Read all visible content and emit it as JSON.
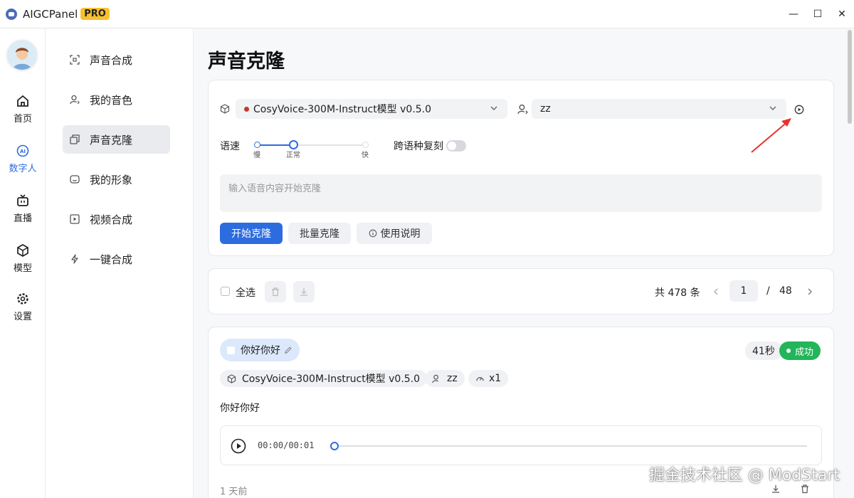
{
  "app": {
    "title": "AIGCPanel",
    "badge": "PRO"
  },
  "window_controls": {
    "minimize": "—",
    "maximize": "☐",
    "close": "✕"
  },
  "rail": {
    "items": [
      {
        "label": "首页",
        "icon": "home-icon"
      },
      {
        "label": "数字人",
        "icon": "ai-icon"
      },
      {
        "label": "直播",
        "icon": "tv-icon"
      },
      {
        "label": "模型",
        "icon": "cube-icon"
      },
      {
        "label": "设置",
        "icon": "gear-icon"
      }
    ],
    "active": "数字人"
  },
  "subnav": {
    "items": [
      {
        "label": "声音合成",
        "icon": "scan-icon"
      },
      {
        "label": "我的音色",
        "icon": "user-voice-icon"
      },
      {
        "label": "声音克隆",
        "icon": "copy-icon"
      },
      {
        "label": "我的形象",
        "icon": "face-icon"
      },
      {
        "label": "视频合成",
        "icon": "video-icon"
      },
      {
        "label": "一键合成",
        "icon": "bolt-icon"
      }
    ],
    "active": "声音克隆"
  },
  "page": {
    "title": "声音克隆"
  },
  "form": {
    "model_select": "CosyVoice-300M-Instruct模型 v0.5.0",
    "model_status_color": "#c0392b",
    "voice_select": "zz",
    "speed_label": "语速",
    "speed_ticks": [
      "慢",
      "正常",
      "快"
    ],
    "speed_value": "正常",
    "cross_lang_label": "跨语种复刻",
    "cross_lang_enabled": false,
    "text_placeholder": "输入语音内容开始克隆",
    "btn_start": "开始克隆",
    "btn_batch": "批量克隆",
    "btn_help": "使用说明"
  },
  "list_toolbar": {
    "select_all": "全选",
    "total": "共 478 条",
    "page_current": "1",
    "page_sep": "/",
    "page_total": "48"
  },
  "record": {
    "title": "你好你好",
    "duration": "41秒",
    "status": "成功",
    "status_color": "#22b55a",
    "model": "CosyVoice-300M-Instruct模型 v0.5.0",
    "voice": "zz",
    "speed": "x1",
    "text": "你好你好",
    "audio_time": "00:00/00:01",
    "time_ago": "1 天前"
  },
  "colors": {
    "accent": "#2d6cdf",
    "active_bg": "#e9ebef"
  },
  "watermark": "掘金技术社区 @ ModStart"
}
